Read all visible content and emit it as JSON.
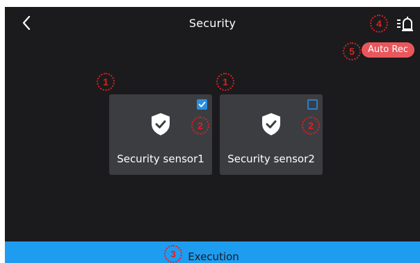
{
  "header": {
    "title": "Security",
    "back_icon": "chevron-left-icon",
    "alarm_icon": "alarm-list-icon"
  },
  "auto_rec": {
    "label": "Auto Rec",
    "color": "#e8575c"
  },
  "sensors": [
    {
      "label": "Security sensor1",
      "icon": "shield-check-icon",
      "checked": true
    },
    {
      "label": "Security sensor2",
      "icon": "shield-check-icon",
      "checked": false
    }
  ],
  "footer": {
    "execute_label": "Execution",
    "color": "#1e9cf0"
  },
  "annotations": {
    "m1a": "1",
    "m1b": "1",
    "m2a": "2",
    "m2b": "2",
    "m3": "3",
    "m4": "4",
    "m5": "5"
  },
  "colors": {
    "background": "#1b1b1d",
    "card": "#3c3d41",
    "checkbox": "#2a8fe0",
    "marker": "#e02020"
  }
}
